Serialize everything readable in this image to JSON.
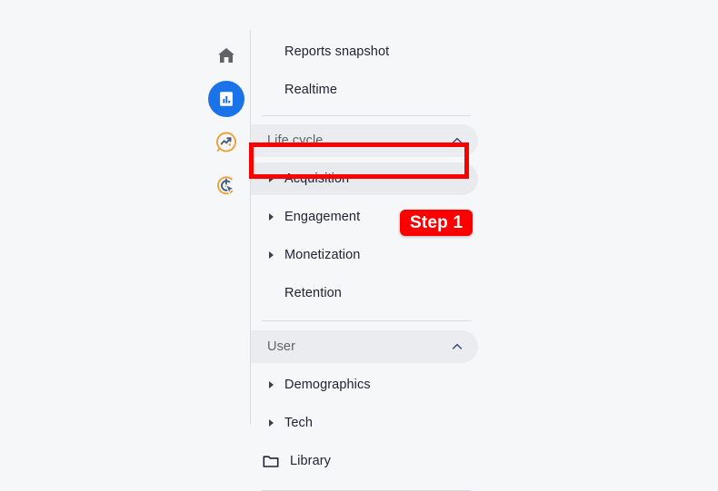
{
  "theme": {
    "page_background": "#f6f7f9",
    "accent_blue": "#1a73e8",
    "annotation_red": "#fc0000",
    "selected_row_background": "#e8eaed",
    "section_row_background": "#ebecef",
    "divider": "#dadce0",
    "label_color": "#202434",
    "section_label_color": "#5f6368"
  },
  "icon_rail": {
    "items": [
      {
        "name": "home-icon",
        "label": "Home",
        "active": false
      },
      {
        "name": "reports-icon",
        "label": "Reports",
        "active": true
      },
      {
        "name": "explore-icon",
        "label": "Explore",
        "active": false
      },
      {
        "name": "advertising-icon",
        "label": "Advertising",
        "active": false
      }
    ]
  },
  "nav": {
    "top_items": [
      {
        "label": "Reports snapshot",
        "expandable": false
      },
      {
        "label": "Realtime",
        "expandable": false
      }
    ],
    "life_cycle": {
      "label": "Life cycle",
      "collapse_icon": "chevron-up-icon",
      "expanded": true,
      "items": [
        {
          "label": "Acquisition",
          "expandable": true,
          "selected": true
        },
        {
          "label": "Engagement",
          "expandable": true,
          "selected": false
        },
        {
          "label": "Monetization",
          "expandable": true,
          "selected": false
        },
        {
          "label": "Retention",
          "expandable": false,
          "selected": false
        }
      ]
    },
    "user": {
      "label": "User",
      "collapse_icon": "chevron-up-icon",
      "expanded": true,
      "items": [
        {
          "label": "Demographics",
          "expandable": true,
          "icon": null
        },
        {
          "label": "Tech",
          "expandable": true,
          "icon": null
        },
        {
          "label": "Library",
          "expandable": false,
          "icon": "folder-icon"
        }
      ]
    }
  },
  "annotations": {
    "step_badge": {
      "label": "Step 1"
    },
    "highlight_target": "Acquisition"
  }
}
